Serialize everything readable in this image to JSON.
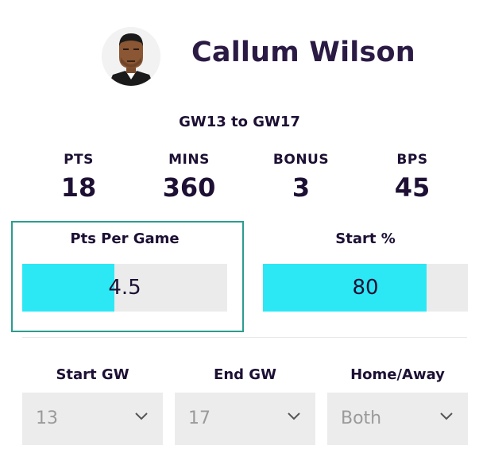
{
  "player": {
    "name": "Callum Wilson",
    "avatar_icon": "player-avatar"
  },
  "range_label": "GW13 to GW17",
  "stats": [
    {
      "label": "PTS",
      "value": "18"
    },
    {
      "label": "MINS",
      "value": "360"
    },
    {
      "label": "BONUS",
      "value": "3"
    },
    {
      "label": "BPS",
      "value": "45"
    }
  ],
  "metrics": [
    {
      "title": "Pts Per Game",
      "value": "4.5",
      "fill_fraction": 0.45
    },
    {
      "title": "Start %",
      "value": "80",
      "fill_fraction": 0.8
    }
  ],
  "filters": [
    {
      "label": "Start GW",
      "value": "13"
    },
    {
      "label": "End GW",
      "value": "17"
    },
    {
      "label": "Home/Away",
      "value": "Both"
    }
  ],
  "colors": {
    "bar_fill": "#2ce8f5",
    "bar_track": "#ebebeb",
    "highlight_border": "#2a9d8f",
    "text": "#1d1034"
  }
}
